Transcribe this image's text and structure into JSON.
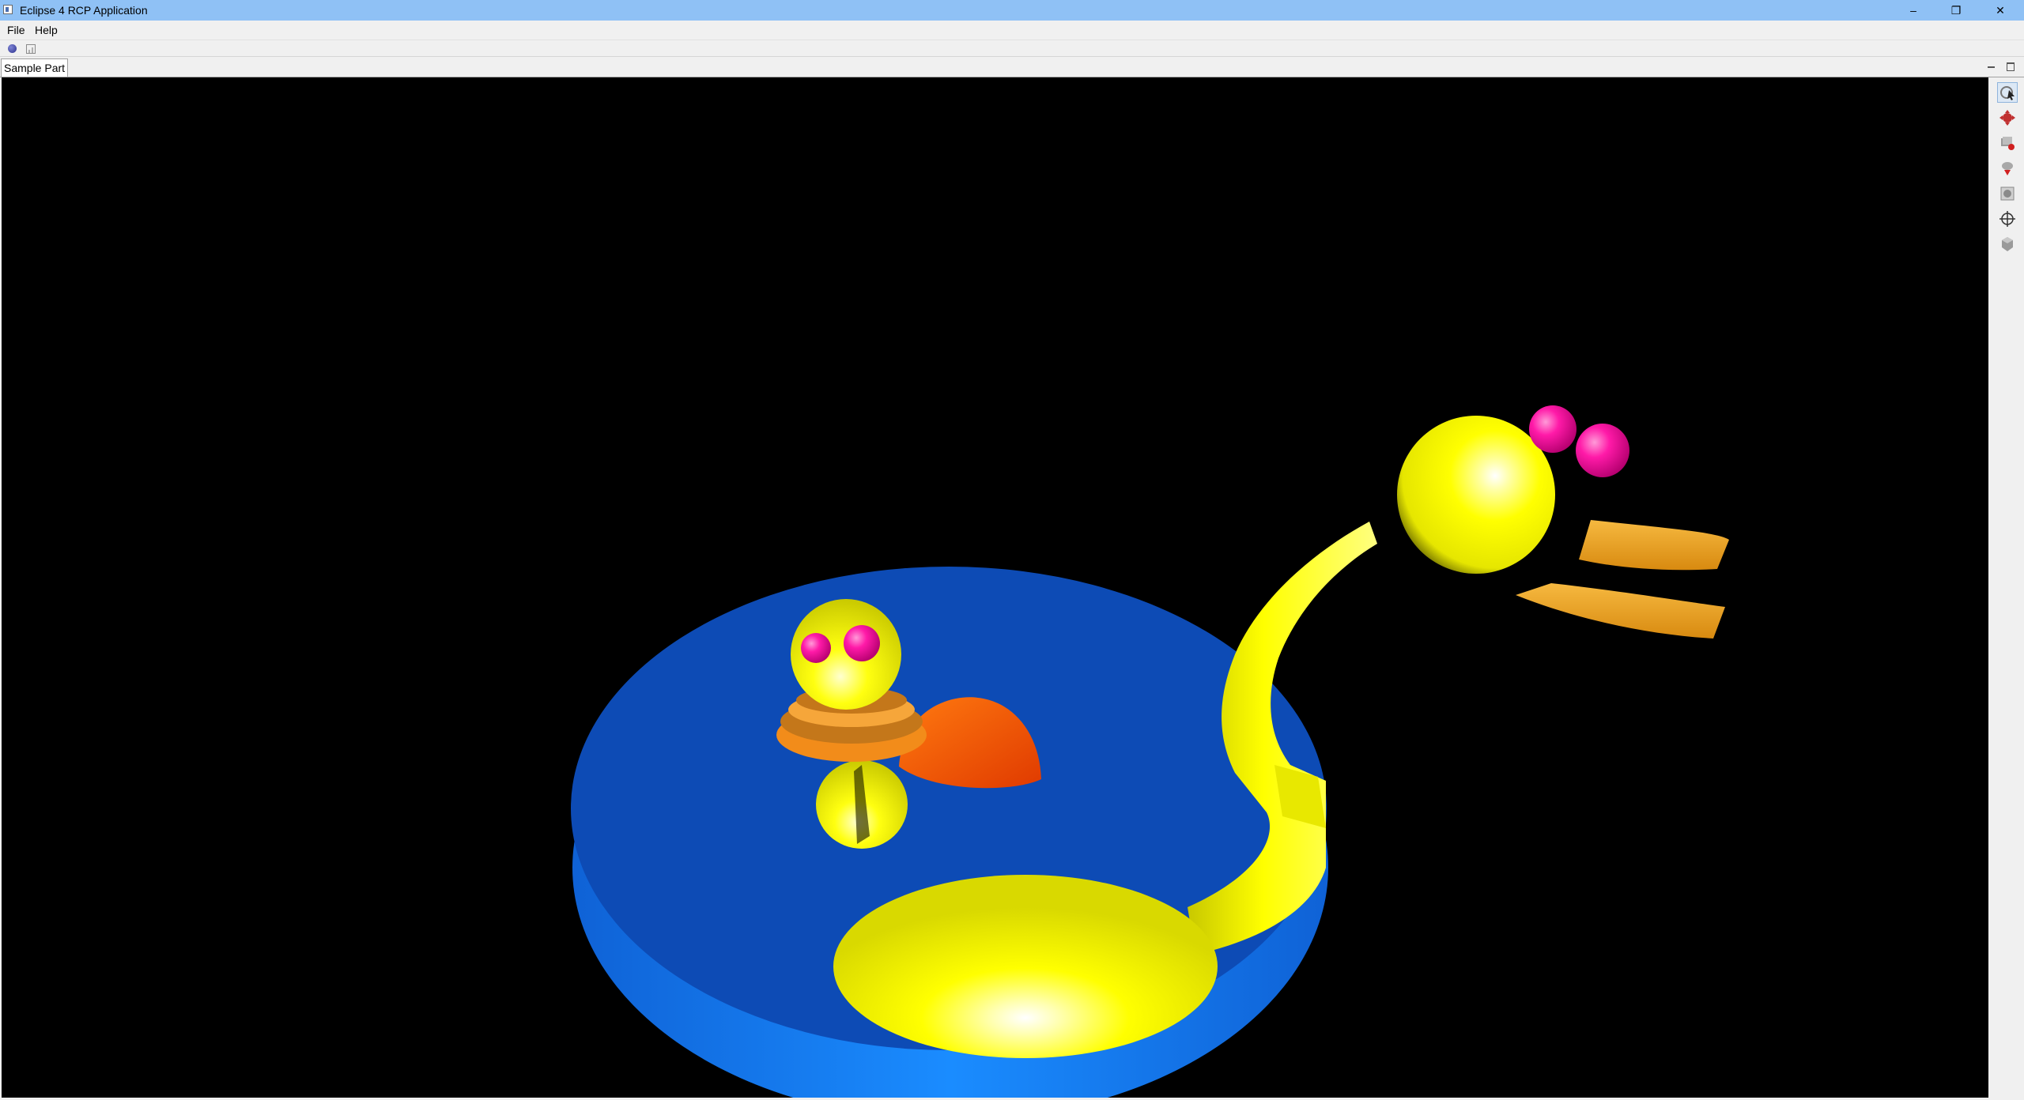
{
  "window": {
    "title": "Eclipse 4 RCP Application",
    "minimize_glyph": "–",
    "maximize_glyph": "❐",
    "close_glyph": "✕"
  },
  "menubar": {
    "items": [
      {
        "label": "File"
      },
      {
        "label": "Help"
      }
    ]
  },
  "toolbar": {
    "buttons": [
      {
        "icon": "circle-sample-icon"
      },
      {
        "icon": "chart-sample-icon"
      }
    ]
  },
  "part": {
    "tab_label": "Sample Part"
  },
  "viewer": {
    "background_color": "#000000",
    "scene": "yellow duck figures on blue disc",
    "side_tools": [
      {
        "icon": "select-rotate-icon",
        "active": true
      },
      {
        "icon": "pan-icon",
        "active": false
      },
      {
        "icon": "zoom-icon",
        "active": false
      },
      {
        "icon": "fit-view-icon",
        "active": false
      },
      {
        "icon": "home-view-icon",
        "active": false
      },
      {
        "icon": "crosshair-icon",
        "active": false
      },
      {
        "icon": "box-view-icon",
        "active": false
      }
    ]
  },
  "colors": {
    "titlebar": "#8fc1f5",
    "disc_top": "#0d4bb5",
    "disc_side": "#1283ff",
    "yellow": "#ffff00",
    "orange": "#f28c1a",
    "pink": "#ff1aa8",
    "dome": "#ff5a0a"
  }
}
